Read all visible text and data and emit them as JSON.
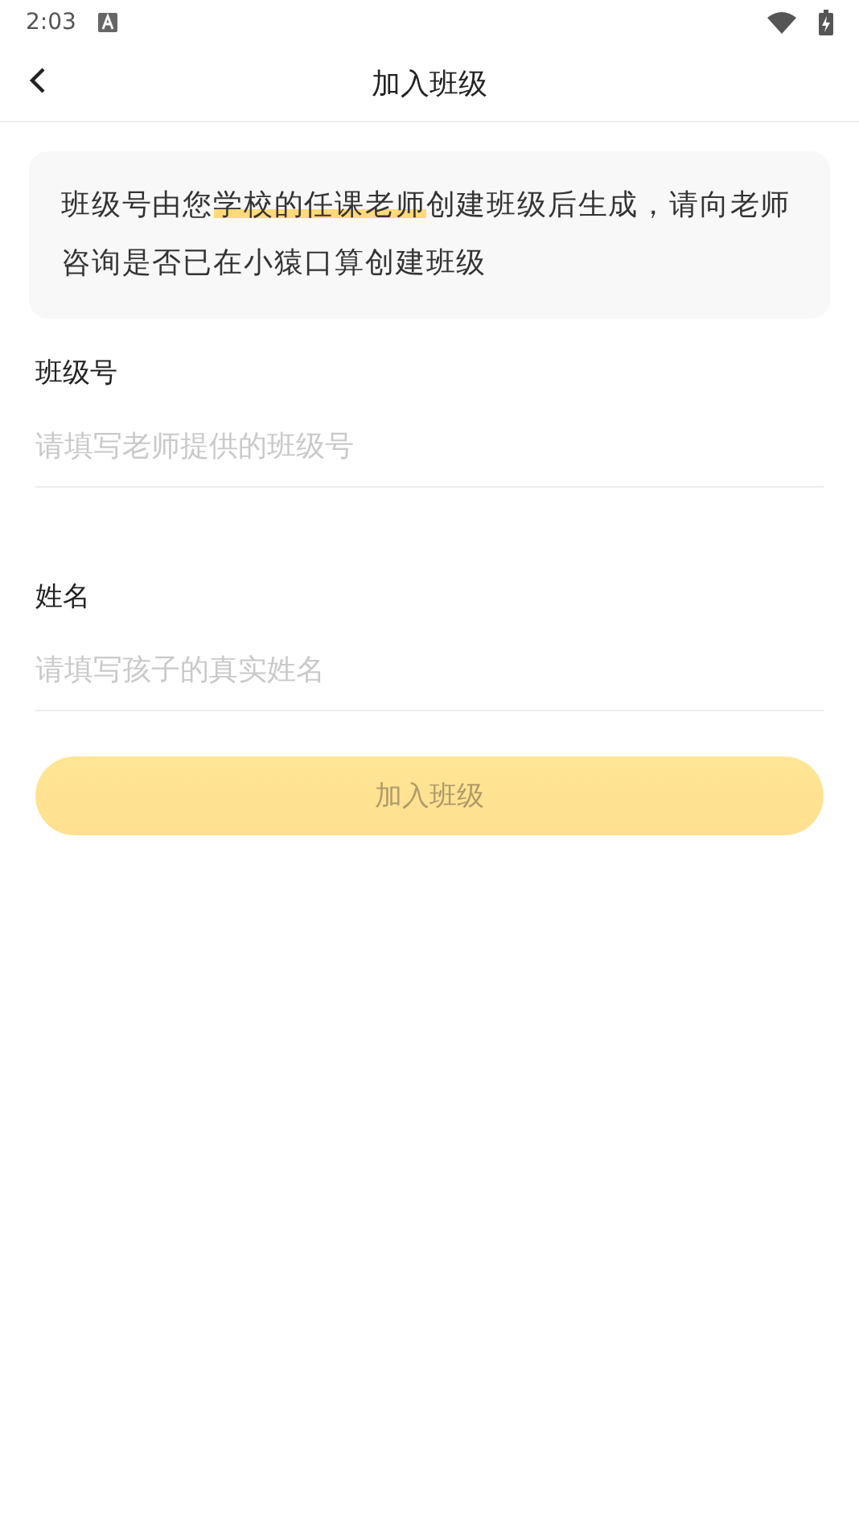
{
  "status_bar": {
    "time": "2:03"
  },
  "header": {
    "title": "加入班级"
  },
  "notice": {
    "parts": [
      {
        "text": "班级号由您",
        "highlighted": false
      },
      {
        "text": "学校的任课老师",
        "highlighted": true
      },
      {
        "text": "创建班级后生成，请向老师咨询是否已在小猿口算创建班级",
        "highlighted": false
      }
    ]
  },
  "fields": [
    {
      "label": "班级号",
      "placeholder": "请填写老师提供的班级号"
    },
    {
      "label": "姓名",
      "placeholder": "请填写孩子的真实姓名"
    }
  ],
  "submit": {
    "label": "加入班级",
    "disabled": true
  }
}
